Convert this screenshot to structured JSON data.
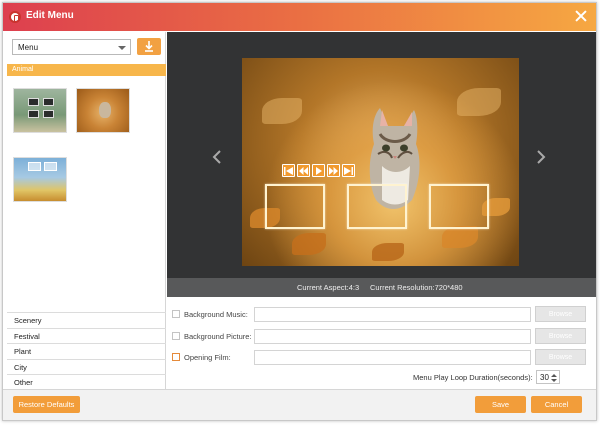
{
  "window": {
    "title": "Edit Menu"
  },
  "left_panel": {
    "menu_select": {
      "value": "Menu"
    },
    "active_category": "Animal",
    "categories": [
      "Scenery",
      "Festival",
      "Plant",
      "City",
      "Other"
    ]
  },
  "preview": {
    "info": {
      "aspect": "Current Aspect:4:3",
      "resolution": "Current Resolution:720*480"
    }
  },
  "options": {
    "background_music": {
      "label": "Background Music:",
      "value": "",
      "button": "Browse"
    },
    "background_picture": {
      "label": "Background Picture:",
      "value": "",
      "button": "Browse"
    },
    "opening_film": {
      "label": "Opening Film:",
      "value": "",
      "button": "Browse"
    },
    "loop_duration": {
      "label": "Menu Play Loop Duration(seconds):",
      "value": "30"
    }
  },
  "footer": {
    "restore_label": "Restore Defaults",
    "save_label": "Save",
    "cancel_label": "Cancel"
  },
  "colors": {
    "accent": "#f29d3a",
    "title_start": "#dd3f4f",
    "title_end": "#f6a842",
    "preview_bg": "#323334"
  }
}
